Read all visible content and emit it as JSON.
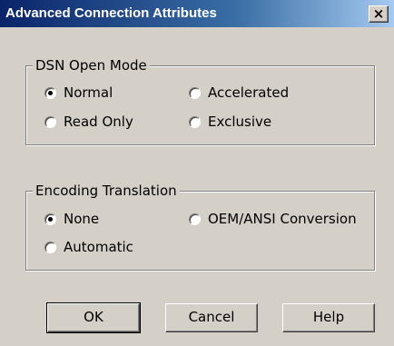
{
  "window": {
    "title": "Advanced Connection Attributes",
    "close_glyph": "×"
  },
  "dsn_open_mode": {
    "title": "DSN Open Mode",
    "options": [
      {
        "label": "Normal",
        "selected": true
      },
      {
        "label": "Accelerated",
        "selected": false
      },
      {
        "label": "Read Only",
        "selected": false
      },
      {
        "label": "Exclusive",
        "selected": false
      }
    ]
  },
  "encoding_translation": {
    "title": "Encoding Translation",
    "options": [
      {
        "label": "None",
        "selected": true
      },
      {
        "label": "OEM/ANSI Conversion",
        "selected": false
      },
      {
        "label": "Automatic",
        "selected": false
      }
    ]
  },
  "buttons": {
    "ok": "OK",
    "cancel": "Cancel",
    "help": "Help"
  },
  "colors": {
    "title_bar_start": "#0a246a",
    "title_bar_end": "#a6caf0",
    "dialog_face": "#d4d0c8"
  }
}
